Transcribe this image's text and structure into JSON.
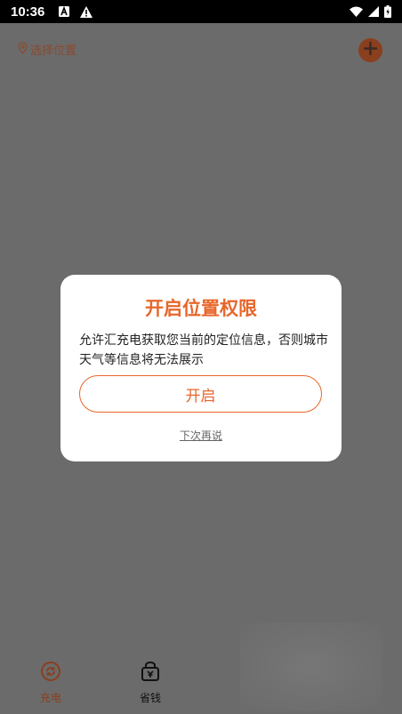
{
  "status_bar": {
    "time": "10:36",
    "left_icons": [
      "app-notification-icon",
      "warning-icon"
    ],
    "right_icons": [
      "wifi-icon",
      "signal-icon",
      "battery-icon"
    ]
  },
  "top_bar": {
    "location_label": "选择位置",
    "location_icon": "location-pin-icon",
    "add_icon": "plus-icon"
  },
  "dialog": {
    "title": "开启位置权限",
    "message": "允许汇充电获取您当前的定位信息，否则城市天气等信息将无法展示",
    "primary_button": "开启",
    "secondary_link": "下次再说"
  },
  "bottom_nav": {
    "items": [
      {
        "label": "充电",
        "icon": "charge-icon",
        "active": true
      },
      {
        "label": "省钱",
        "icon": "savings-bag-icon",
        "active": false
      }
    ]
  },
  "colors": {
    "accent": "#e8662a",
    "accent_dim": "#8a3f1e",
    "overlay": "#6b6b6b"
  }
}
